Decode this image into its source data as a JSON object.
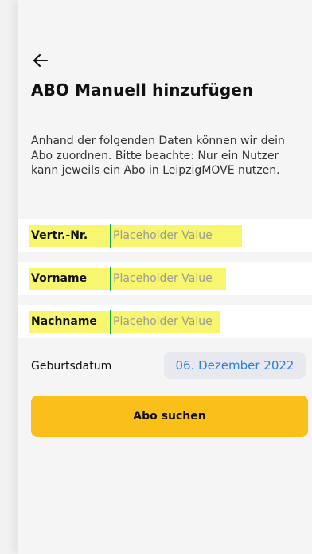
{
  "header": {
    "back_icon": "arrow-left-icon",
    "title": "ABO Manuell hinzufügen"
  },
  "intro": {
    "text": "Anhand der folgenden Daten können wir dein Abo zuordnen. Bitte beachte: Nur ein Nutzer kann jeweils ein Abo in LeipzigMOVE nutzen."
  },
  "form": {
    "contract_number": {
      "label": "Vertr.-Nr.",
      "placeholder": "Placeholder Value",
      "value": ""
    },
    "first_name": {
      "label": "Vorname",
      "placeholder": "Placeholder Value",
      "value": ""
    },
    "last_name": {
      "label": "Nachname",
      "placeholder": "Placeholder Value",
      "value": ""
    },
    "birthdate": {
      "label": "Geburtsdatum",
      "value": "06. Dezember 2022"
    }
  },
  "actions": {
    "search_label": "Abo suchen"
  },
  "colors": {
    "accent_yellow": "#fbbf1a",
    "highlight_yellow": "#f7f55a",
    "link_blue": "#2f7de1",
    "cursor_green": "#1a9f52"
  }
}
